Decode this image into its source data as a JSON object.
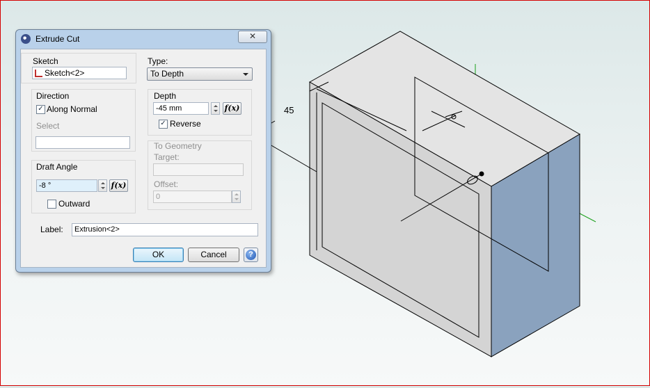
{
  "dialog": {
    "title": "Extrude Cut",
    "close_symbol": "✕",
    "sketch": {
      "group_label": "Sketch",
      "value": "Sketch<2>"
    },
    "type": {
      "label": "Type:",
      "selected": "To Depth"
    },
    "direction": {
      "group_label": "Direction",
      "along_normal_label": "Along Normal",
      "along_normal_checked": true,
      "select_label": "Select",
      "select_value": ""
    },
    "depth": {
      "group_label": "Depth",
      "value": "-45 mm",
      "fx_label": "f(x)",
      "reverse_label": "Reverse",
      "reverse_checked": true
    },
    "to_geometry": {
      "group_label": "To Geometry",
      "target_label": "Target:",
      "target_value": "",
      "offset_label": "Offset:",
      "offset_value": "0"
    },
    "draft_angle": {
      "group_label": "Draft Angle",
      "value": "-8 °",
      "fx_label": "f(x)",
      "outward_label": "Outward",
      "outward_checked": false
    },
    "label_field": {
      "label": "Label:",
      "value": "Extrusion<2>"
    },
    "buttons": {
      "ok": "OK",
      "cancel": "Cancel",
      "help": "?"
    }
  },
  "viewport": {
    "dimension_value": "45",
    "colors": {
      "top_face": "#e4e4e4",
      "front_face": "#d4d4d4",
      "side_face": "#8aa2be",
      "axis_green": "#1aa01a",
      "frame_red": "#d40000"
    }
  }
}
